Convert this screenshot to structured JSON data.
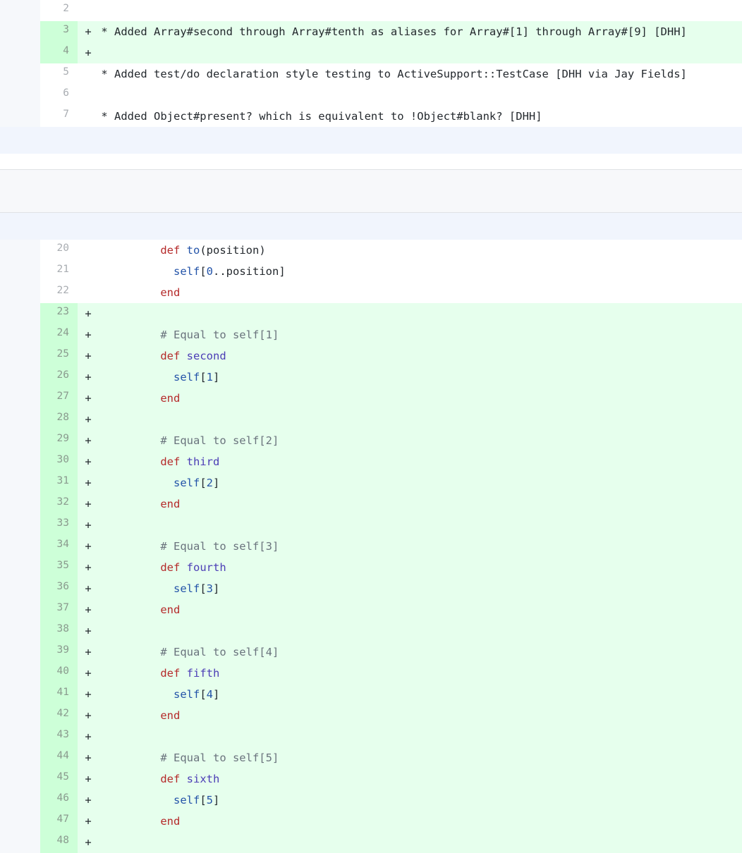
{
  "diff": {
    "hunk1": [
      {
        "num": "2",
        "type": "ctx",
        "sign": "",
        "text": ""
      },
      {
        "num": "3",
        "type": "add",
        "sign": "+",
        "text": "* Added Array#second through Array#tenth as aliases for Array#[1] through Array#[9] [DHH]"
      },
      {
        "num": "4",
        "type": "add",
        "sign": "+",
        "text": ""
      },
      {
        "num": "5",
        "type": "ctx",
        "sign": "",
        "text": "* Added test/do declaration style testing to ActiveSupport::TestCase [DHH via Jay Fields]"
      },
      {
        "num": "6",
        "type": "ctx",
        "sign": "",
        "text": ""
      },
      {
        "num": "7",
        "type": "ctx",
        "sign": "",
        "text": "* Added Object#present? which is equivalent to !Object#blank? [DHH]"
      }
    ],
    "hunk2": {
      "ctx": [
        {
          "num": "20",
          "kw": "def",
          "name": "to",
          "rest": "(position)"
        },
        {
          "num": "21",
          "self": "self",
          "open": "[",
          "idx": "0",
          "rest": "..position]"
        },
        {
          "num": "22",
          "kw": "end"
        }
      ],
      "added": [
        {
          "num": "23",
          "sign": "+",
          "kind": "blank"
        },
        {
          "num": "24",
          "sign": "+",
          "kind": "comment",
          "text": "# Equal to self[1]"
        },
        {
          "num": "25",
          "sign": "+",
          "kind": "def",
          "kw": "def",
          "name": "second"
        },
        {
          "num": "26",
          "sign": "+",
          "kind": "self",
          "self": "self",
          "idx": "1"
        },
        {
          "num": "27",
          "sign": "+",
          "kind": "end",
          "kw": "end"
        },
        {
          "num": "28",
          "sign": "+",
          "kind": "blank"
        },
        {
          "num": "29",
          "sign": "+",
          "kind": "comment",
          "text": "# Equal to self[2]"
        },
        {
          "num": "30",
          "sign": "+",
          "kind": "def",
          "kw": "def",
          "name": "third"
        },
        {
          "num": "31",
          "sign": "+",
          "kind": "self",
          "self": "self",
          "idx": "2"
        },
        {
          "num": "32",
          "sign": "+",
          "kind": "end",
          "kw": "end"
        },
        {
          "num": "33",
          "sign": "+",
          "kind": "blank"
        },
        {
          "num": "34",
          "sign": "+",
          "kind": "comment",
          "text": "# Equal to self[3]"
        },
        {
          "num": "35",
          "sign": "+",
          "kind": "def",
          "kw": "def",
          "name": "fourth"
        },
        {
          "num": "36",
          "sign": "+",
          "kind": "self",
          "self": "self",
          "idx": "3"
        },
        {
          "num": "37",
          "sign": "+",
          "kind": "end",
          "kw": "end"
        },
        {
          "num": "38",
          "sign": "+",
          "kind": "blank"
        },
        {
          "num": "39",
          "sign": "+",
          "kind": "comment",
          "text": "# Equal to self[4]"
        },
        {
          "num": "40",
          "sign": "+",
          "kind": "def",
          "kw": "def",
          "name": "fifth"
        },
        {
          "num": "41",
          "sign": "+",
          "kind": "self",
          "self": "self",
          "idx": "4"
        },
        {
          "num": "42",
          "sign": "+",
          "kind": "end",
          "kw": "end"
        },
        {
          "num": "43",
          "sign": "+",
          "kind": "blank"
        },
        {
          "num": "44",
          "sign": "+",
          "kind": "comment",
          "text": "# Equal to self[5]"
        },
        {
          "num": "45",
          "sign": "+",
          "kind": "def",
          "kw": "def",
          "name": "sixth"
        },
        {
          "num": "46",
          "sign": "+",
          "kind": "self",
          "self": "self",
          "idx": "5"
        },
        {
          "num": "47",
          "sign": "+",
          "kind": "end",
          "kw": "end"
        },
        {
          "num": "48",
          "sign": "+",
          "kind": "blank"
        }
      ]
    }
  },
  "colors": {
    "added_bg": "#e6ffed",
    "added_num_bg": "#cdffd8",
    "keyword": "#b52a2a",
    "method_name": "#4b3db6",
    "self": "#2353a8",
    "comment": "#6a737d"
  }
}
